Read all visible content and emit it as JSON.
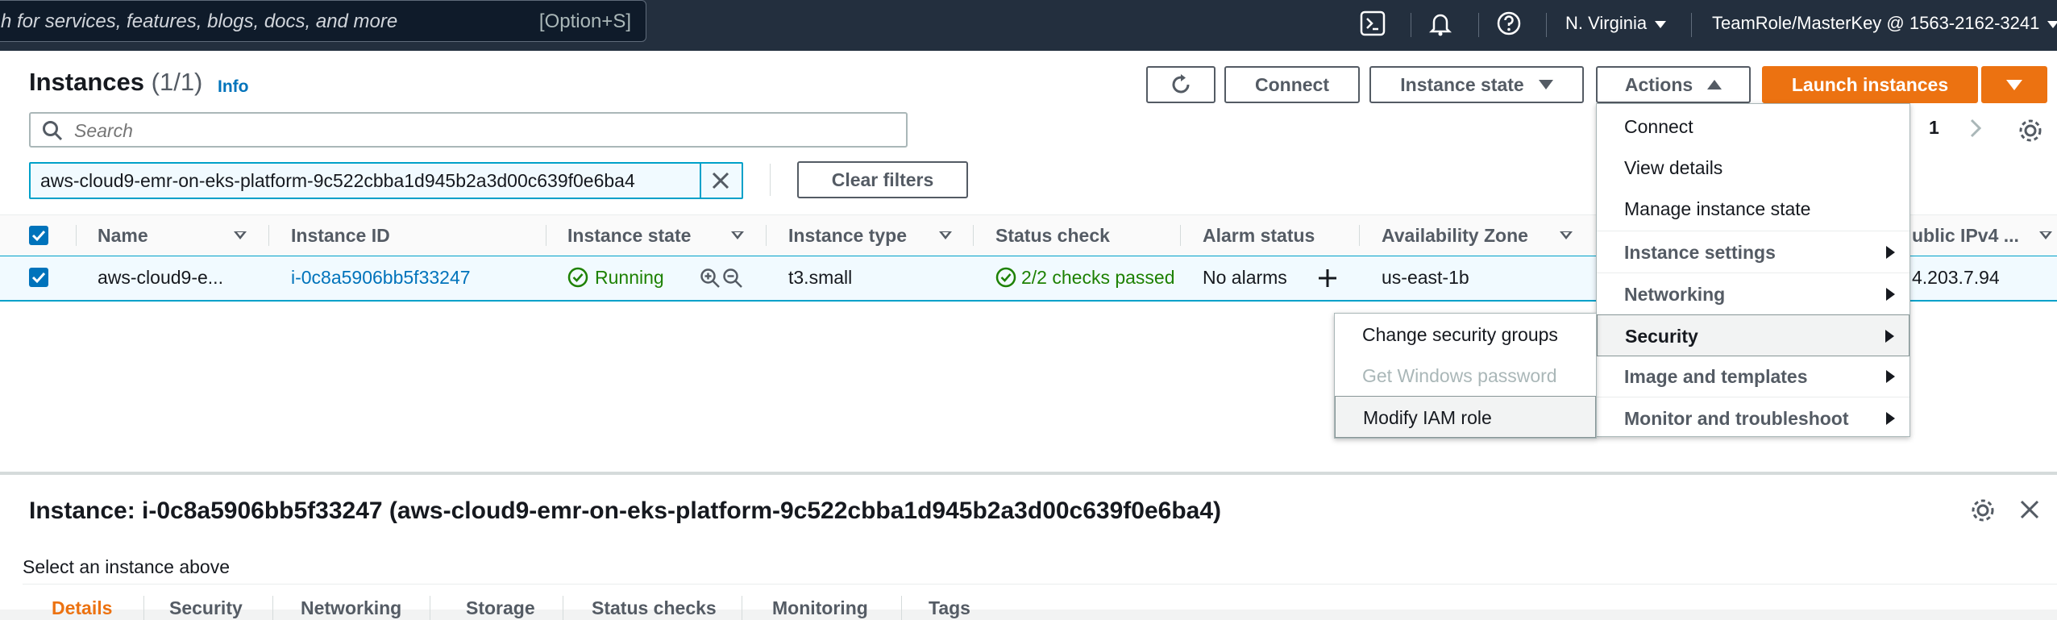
{
  "topnav": {
    "search_placeholder": "h for services, features, blogs, docs, and more",
    "search_shortcut": "[Option+S]",
    "region": "N. Virginia",
    "account": "TeamRole/MasterKey @ 1563-2162-3241"
  },
  "header": {
    "title": "Instances",
    "count": "(1/1)",
    "info": "Info"
  },
  "toolbar": {
    "connect": "Connect",
    "instance_state": "Instance state",
    "actions": "Actions",
    "launch": "Launch instances"
  },
  "search": {
    "placeholder": "Search"
  },
  "filter": {
    "token": "aws-cloud9-emr-on-eks-platform-9c522cbba1d945b2a3d00c639f0e6ba4",
    "clear": "Clear filters"
  },
  "pagination": {
    "page": "1"
  },
  "table": {
    "headers": [
      "Name",
      "Instance ID",
      "Instance state",
      "Instance type",
      "Status check",
      "Alarm status",
      "Availability Zone",
      "ublic IPv4 ..."
    ],
    "row": {
      "name": "aws-cloud9-e...",
      "instance_id": "i-0c8a5906bb5f33247",
      "state": "Running",
      "type": "t3.small",
      "status_check": "2/2 checks passed",
      "alarm": "No alarms",
      "az": "us-east-1b",
      "ipv4": "4.203.7.94"
    }
  },
  "actions_menu": {
    "items": [
      "Connect",
      "View details",
      "Manage instance state"
    ],
    "groups": [
      "Instance settings",
      "Networking",
      "Security",
      "Image and templates",
      "Monitor and troubleshoot"
    ]
  },
  "security_submenu": {
    "items": [
      "Change security groups",
      "Get Windows password",
      "Modify IAM role"
    ]
  },
  "detail": {
    "title": "Instance: i-0c8a5906bb5f33247 (aws-cloud9-emr-on-eks-platform-9c522cbba1d945b2a3d00c639f0e6ba4)",
    "hint": "Select an instance above",
    "tabs": [
      "Details",
      "Security",
      "Networking",
      "Storage",
      "Status checks",
      "Monitoring",
      "Tags"
    ]
  },
  "colors": {
    "primary": "#ec7211",
    "link": "#0073bb",
    "success": "#1d8102",
    "nav": "#232f3e"
  }
}
